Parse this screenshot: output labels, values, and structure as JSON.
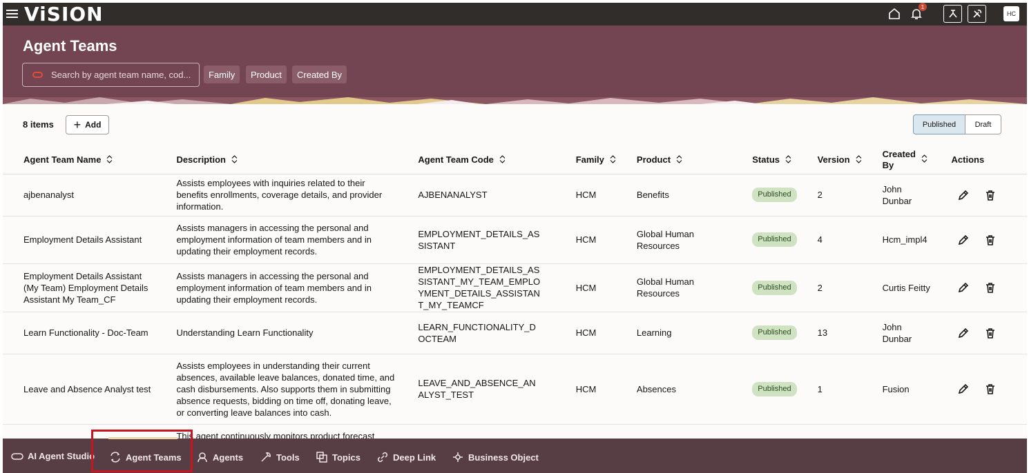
{
  "app": {
    "logo": "ViSION"
  },
  "topbar": {
    "notification_count": "1",
    "avatar_initials": "HC"
  },
  "header": {
    "title": "Agent Teams",
    "search_placeholder": "Search by agent team name, cod...",
    "filters": [
      "Family",
      "Product",
      "Created By"
    ]
  },
  "toolbar": {
    "count_label": "8 items",
    "add_label": "Add",
    "segments": [
      "Published",
      "Draft"
    ],
    "selected_segment": "Published"
  },
  "table": {
    "columns": [
      "Agent Team Name",
      "Description",
      "Agent Team Code",
      "Family",
      "Product",
      "Status",
      "Version",
      "Created By",
      "Actions"
    ],
    "rows": [
      {
        "name": "ajbenanalyst",
        "description": "Assists employees with inquiries related to their benefits enrollments, coverage details, and provider information.",
        "code": "AJBENANALYST",
        "family": "HCM",
        "product": "Benefits",
        "status": "Published",
        "version": "2",
        "created_by": "John Dunbar"
      },
      {
        "name": "Employment Details Assistant",
        "description": "Assists managers in accessing the personal and employment information of team members and in updating their employment records.",
        "code": "EMPLOYMENT_DETAILS_ASSISTANT",
        "family": "HCM",
        "product": "Global Human Resources",
        "status": "Published",
        "version": "4",
        "created_by": "Hcm_impl4"
      },
      {
        "name": "Employment Details Assistant (My Team) Employment Details Assistant My Team_CF",
        "description": "Assists managers in accessing the personal and employment information of team members and in updating their employment records.",
        "code": "EMPLOYMENT_DETAILS_ASSISTANT_MY_TEAM_EMPLOYMENT_DETAILS_ASSISTANT_MY_TEAMCF",
        "family": "HCM",
        "product": "Global Human Resources",
        "status": "Published",
        "version": "2",
        "created_by": "Curtis Feitty"
      },
      {
        "name": "Learn Functionality - Doc-Team",
        "description": "Understanding Learn Functionality",
        "code": "LEARN_FUNCTIONALITY_DOCTEAM",
        "family": "HCM",
        "product": "Learning",
        "status": "Published",
        "version": "13",
        "created_by": "John Dunbar"
      },
      {
        "name": "Leave and Absence Analyst test",
        "description": "Assists employees in understanding their current absences, available leave balances, donated time, and cash disbursements. Also supports them in submitting absence requests, bidding on time off, donating leave, or converting leave balances into cash.",
        "code": "LEAVE_AND_ABSENCE_ANALYST_TEST",
        "family": "HCM",
        "product": "Absences",
        "status": "Published",
        "version": "1",
        "created_by": "Fusion"
      },
      {
        "name": "",
        "description": "This agent continuously monitors product forecast",
        "code": "",
        "family": "",
        "product": "",
        "status": "",
        "version": "",
        "created_by": ""
      }
    ]
  },
  "bottom_nav": {
    "items": [
      "AI Agent Studio",
      "Agent Teams",
      "Agents",
      "Tools",
      "Topics",
      "Deep Link",
      "Business Object"
    ],
    "active": "Agent Teams"
  },
  "colors": {
    "header": "#734451",
    "topbar": "#312d2a",
    "bottombar": "#573d44",
    "status_pill": "#cfe3c3",
    "highlight": "#c7161f"
  }
}
